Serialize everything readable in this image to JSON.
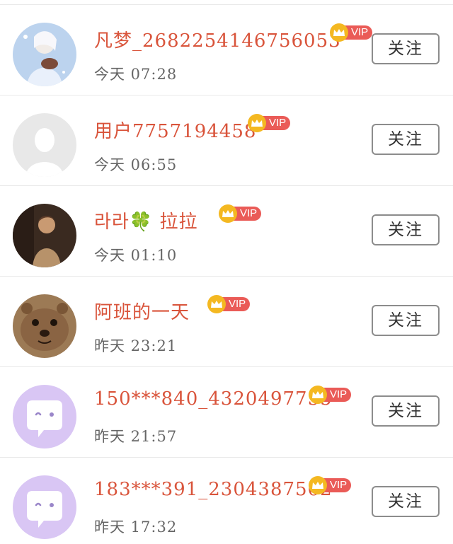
{
  "users": [
    {
      "name": "凡梦_2682254146756053",
      "time": "今天  07:28",
      "vip": "VIP",
      "follow": "关注"
    },
    {
      "name": "用户7757194458",
      "time": "今天  06:55",
      "vip": "VIP",
      "follow": "关注"
    },
    {
      "name": "라라🍀 拉拉",
      "time": "今天  01:10",
      "vip": "VIP",
      "follow": "关注"
    },
    {
      "name": "阿班的一天",
      "time": "昨天  23:21",
      "vip": "VIP",
      "follow": "关注"
    },
    {
      "name": "150***840_4320497755",
      "time": "昨天  21:57",
      "vip": "VIP",
      "follow": "关注"
    },
    {
      "name": "183***391_2304387562",
      "time": "昨天  17:32",
      "vip": "VIP",
      "follow": "关注"
    }
  ],
  "colors": {
    "name": "#d9543b",
    "vip_badge": "#ea5b57",
    "crown": "#f4b821",
    "default_avatar": "#d9c6f4"
  }
}
